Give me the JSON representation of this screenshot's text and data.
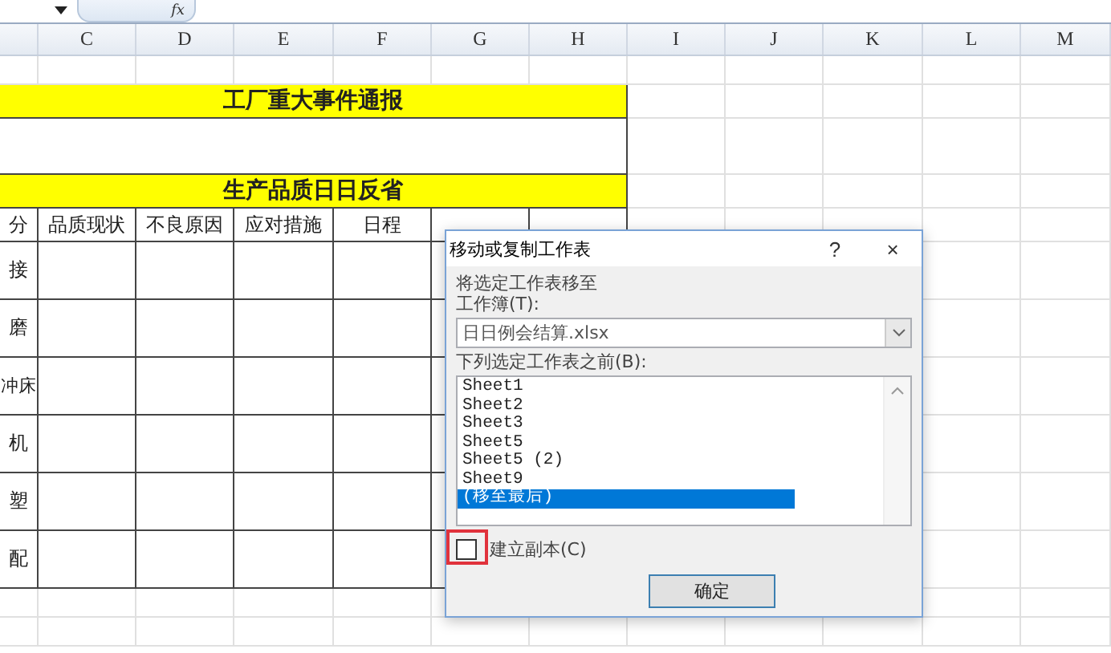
{
  "formula_bar": {
    "function_label": "fx"
  },
  "columns": [
    "C",
    "D",
    "E",
    "F",
    "G",
    "H",
    "I",
    "J",
    "K",
    "L",
    "M"
  ],
  "rows": [
    {
      "kind": "grid"
    },
    {
      "kind": "title",
      "text": "工厂重大事件通报"
    },
    {
      "kind": "merged"
    },
    {
      "kind": "title",
      "text": "生产品质日日反省"
    },
    {
      "kind": "header",
      "cells": [
        "分",
        "品质现状",
        "不良原因",
        "应对措施",
        "日程"
      ]
    },
    {
      "kind": "data",
      "cells": [
        "接"
      ]
    },
    {
      "kind": "data",
      "cells": [
        "磨"
      ]
    },
    {
      "kind": "data",
      "cells": [
        "冲床"
      ]
    },
    {
      "kind": "data",
      "cells": [
        "机"
      ]
    },
    {
      "kind": "data",
      "cells": [
        "塑"
      ]
    },
    {
      "kind": "data",
      "cells": [
        "配"
      ]
    },
    {
      "kind": "grid"
    },
    {
      "kind": "grid"
    }
  ],
  "dialog": {
    "title": "移动或复制工作表",
    "help": "?",
    "close": "×",
    "move_label": "将选定工作表移至",
    "workbook_label": "工作簿(T):",
    "workbook": "日日例会结算.xlsx",
    "before_label": "下列选定工作表之前(B):",
    "sheets": [
      {
        "label": "Sheet1",
        "selected": false
      },
      {
        "label": "Sheet2",
        "selected": false
      },
      {
        "label": "Sheet3",
        "selected": false
      },
      {
        "label": "Sheet5",
        "selected": false
      },
      {
        "label": "Sheet5 (2)",
        "selected": false
      },
      {
        "label": "Sheet9",
        "selected": false
      },
      {
        "label": "(移至最后)",
        "selected": true
      }
    ],
    "copy": {
      "label": "建立副本(C)",
      "checked": false,
      "highlighted": true
    },
    "ok": "确定"
  }
}
